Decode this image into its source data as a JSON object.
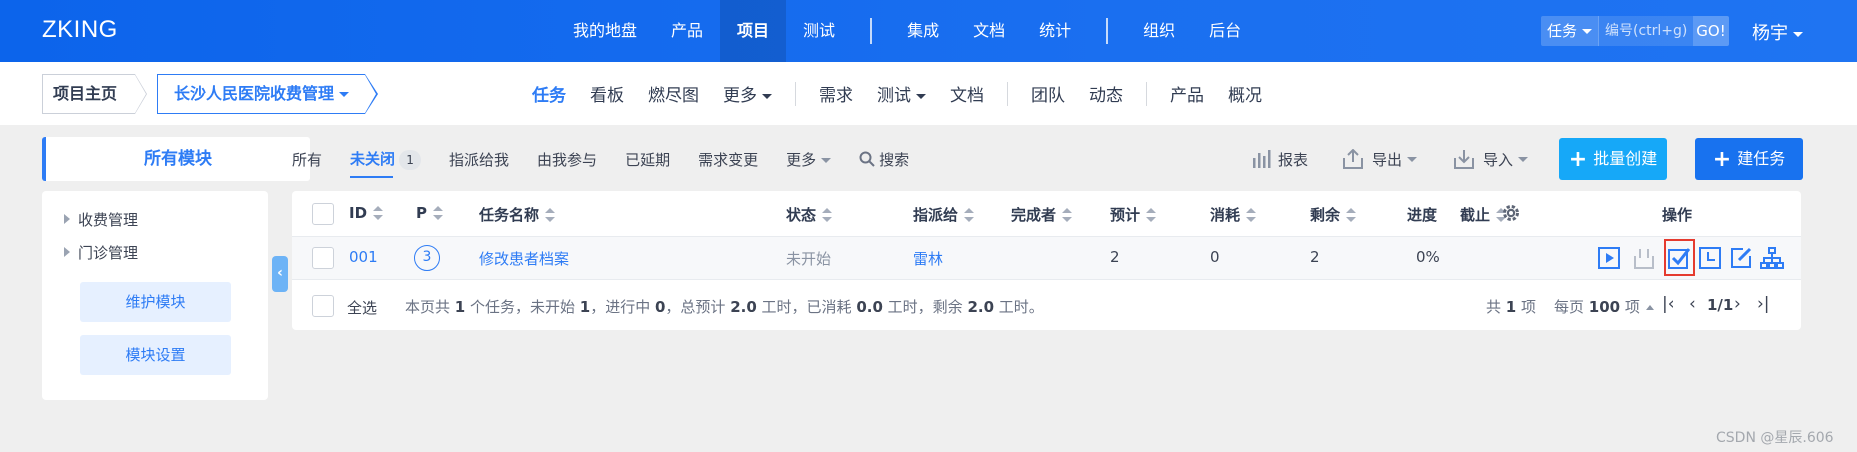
{
  "header": {
    "brand": "ZKING",
    "nav_group1": [
      "我的地盘",
      "产品",
      "项目",
      "测试"
    ],
    "nav_group2": [
      "集成",
      "文档",
      "统计"
    ],
    "nav_group3": [
      "组织",
      "后台"
    ],
    "active_nav": "项目",
    "search": {
      "type": "任务",
      "placeholder": "编号(ctrl+g)",
      "go": "GO!"
    },
    "user": "杨宇"
  },
  "breadcrumb": {
    "home": "项目主页",
    "project": "长沙人民医院收费管理"
  },
  "subnav": {
    "group1": [
      "任务",
      "看板",
      "燃尽图",
      "更多"
    ],
    "group2": [
      "需求",
      "测试",
      "文档"
    ],
    "group3": [
      "团队",
      "动态"
    ],
    "group4": [
      "产品",
      "概况"
    ],
    "active": "任务"
  },
  "modules": {
    "title": "所有模块",
    "items": [
      "收费管理",
      "门诊管理"
    ],
    "maintain": "维护模块",
    "settings": "模块设置"
  },
  "filters": {
    "items": [
      "所有",
      "未关闭",
      "指派给我",
      "由我参与",
      "已延期",
      "需求变更",
      "更多"
    ],
    "active": "未关闭",
    "unclosed_count": "1",
    "search": "搜索"
  },
  "toolbar": {
    "report": "报表",
    "export": "导出",
    "import": "导入",
    "batch_create": "批量创建",
    "create": "建任务"
  },
  "table": {
    "columns": {
      "id": "ID",
      "pri": "P",
      "name": "任务名称",
      "status": "状态",
      "assigned": "指派给",
      "finished_by": "完成者",
      "estimate": "预计",
      "consumed": "消耗",
      "left": "剩余",
      "progress": "进度",
      "deadline": "截止",
      "actions": "操作"
    },
    "rows": [
      {
        "id": "001",
        "pri": "3",
        "name": "修改患者档案",
        "status": "未开始",
        "assigned": "雷林",
        "finished_by": "",
        "estimate": "2",
        "consumed": "0",
        "left": "2",
        "progress": "0%",
        "deadline": ""
      }
    ],
    "actions": [
      "start-icon",
      "pause-icon",
      "finish-icon",
      "record-hours-icon",
      "edit-icon",
      "subtask-icon"
    ]
  },
  "footer": {
    "select_all": "全选",
    "summary_parts": [
      "本页共 ",
      "1",
      " 个任务，未开始 ",
      "1",
      "，进行中 ",
      "0",
      "，总预计 ",
      "2.0",
      " 工时，已消耗 ",
      "0.0",
      " 工时，剩余 ",
      "2.0",
      " 工时。"
    ],
    "total_pre": "共 ",
    "total": "1",
    "total_post": " 项",
    "per_page_pre": "每页 ",
    "per_page": "100",
    "per_page_post": " 项",
    "page": "1/1"
  },
  "watermark": "CSDN @星辰.606",
  "colors": {
    "primary": "#2e7cf5",
    "header": "#1a6ff0",
    "batch_button": "#16a8f8",
    "highlight": "#e53b2f"
  }
}
